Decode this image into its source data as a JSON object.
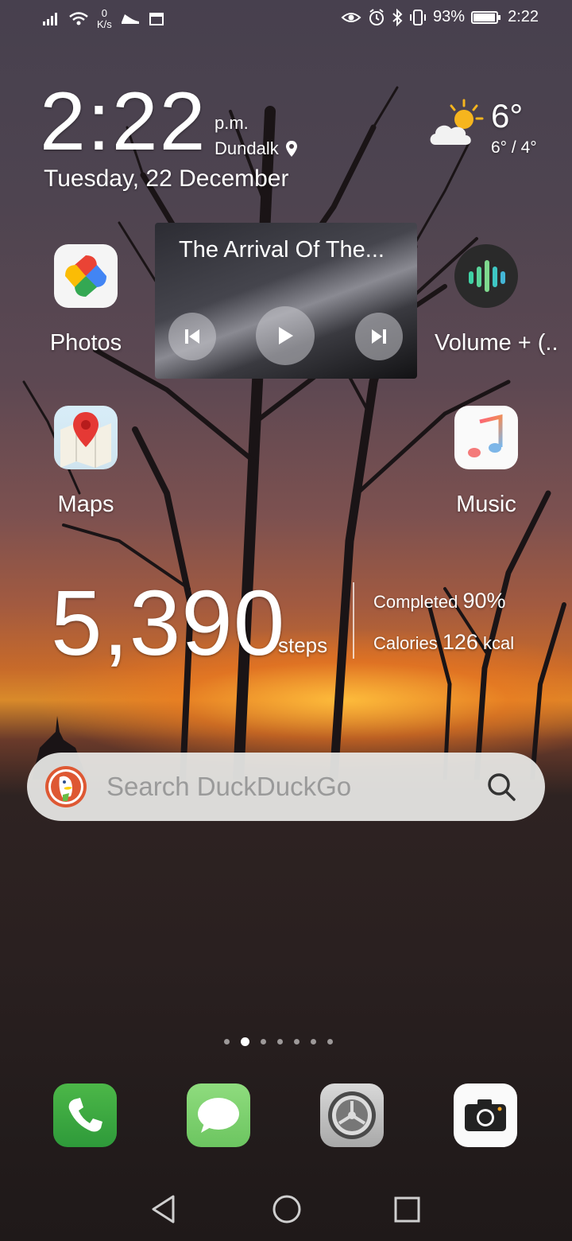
{
  "status_bar": {
    "net_speed_value": "0",
    "net_speed_unit": "K/s",
    "battery": "93%",
    "time": "2:22"
  },
  "clock_widget": {
    "time": "2:22",
    "ampm": "p.m.",
    "location": "Dundalk",
    "date": "Tuesday, 22 December"
  },
  "weather_widget": {
    "temperature": "6°",
    "range": "6° / 4°",
    "icon": "partly-cloudy-icon"
  },
  "apps": {
    "photos": "Photos",
    "maps": "Maps",
    "volume": "Volume + (..",
    "music": "Music"
  },
  "music_widget": {
    "title": "The Arrival Of The..."
  },
  "health_widget": {
    "steps": "5,390",
    "steps_unit": "steps",
    "completed_label": "Completed",
    "completed_value": "90%",
    "calories_label": "Calories",
    "calories_value": "126",
    "calories_unit": "kcal"
  },
  "search_bar": {
    "placeholder": "Search DuckDuckGo"
  },
  "page_indicator": {
    "pages": 7,
    "active_index": 1
  },
  "dock": [
    "phone-icon",
    "messages-icon",
    "settings-icon",
    "camera-icon"
  ]
}
